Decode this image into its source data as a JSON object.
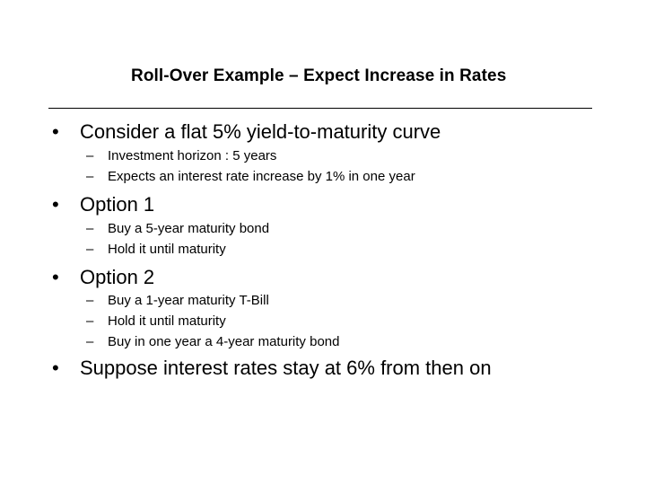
{
  "slide": {
    "title": "Roll-Over Example – Expect Increase in Rates",
    "bullet_glyph": "•",
    "dash_glyph": "–",
    "bullets": [
      {
        "text": "Consider a flat 5% yield-to-maturity curve",
        "subs": [
          "Investment horizon : 5 years",
          "Expects an interest rate increase by 1% in one year"
        ]
      },
      {
        "text": "Option 1",
        "subs": [
          "Buy a 5-year maturity bond",
          "Hold it until maturity"
        ]
      },
      {
        "text": "Option 2",
        "subs": [
          "Buy a 1-year maturity T-Bill",
          "Hold it until maturity",
          "Buy in one year a 4-year maturity bond"
        ]
      },
      {
        "text": "Suppose interest rates stay at 6% from then on",
        "subs": []
      }
    ]
  }
}
